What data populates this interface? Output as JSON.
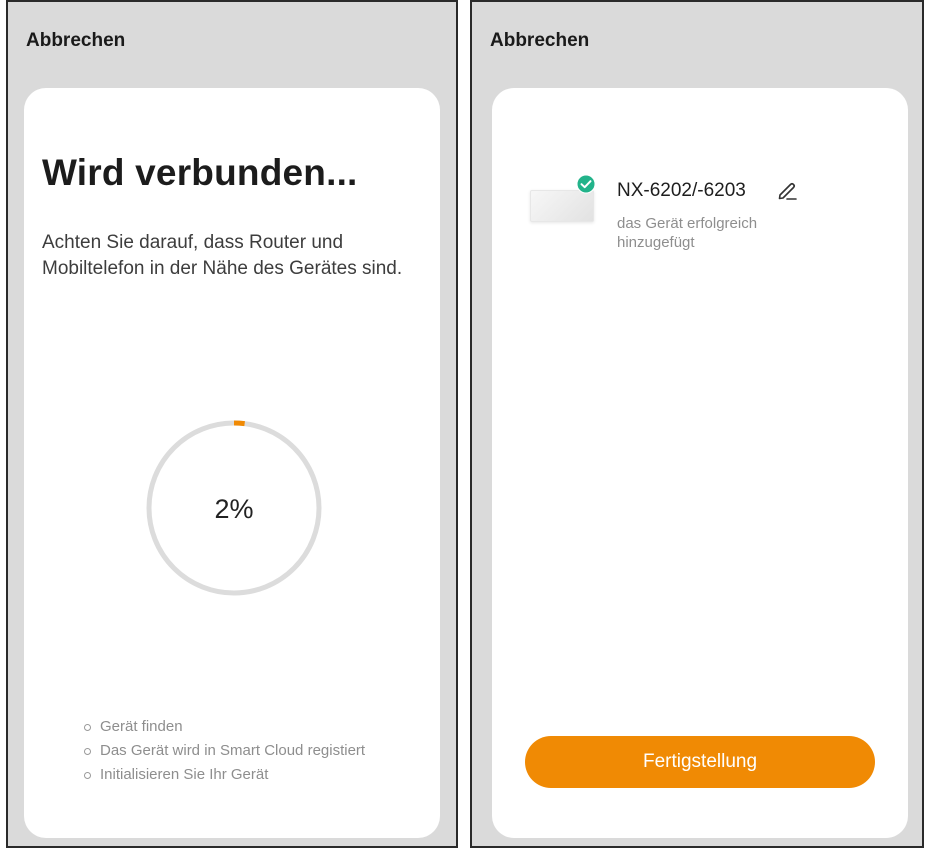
{
  "left_screen": {
    "cancel_label": "Abbrechen",
    "title": "Wird verbunden...",
    "subtitle": "Achten Sie darauf, dass Router und Mobiltelefon in der Nähe des Gerätes sind.",
    "progress": {
      "value_percent": 2,
      "label": "2%",
      "track_color": "#dcdcdc",
      "fill_color": "#f08a04"
    },
    "steps": [
      "Gerät finden",
      "Das Gerät wird in Smart Cloud registiert",
      "Initialisieren Sie Ihr Gerät"
    ]
  },
  "right_screen": {
    "cancel_label": "Abbrechen",
    "device": {
      "name": "NX-6202/-6203",
      "status": "das Gerät erfolgreich hinzugefügt",
      "badge_icon": "check-circle-icon",
      "edit_icon": "pencil-icon",
      "badge_color": "#22b38a"
    },
    "finish_button_label": "Fertigstellung",
    "accent_color": "#f08a04"
  }
}
